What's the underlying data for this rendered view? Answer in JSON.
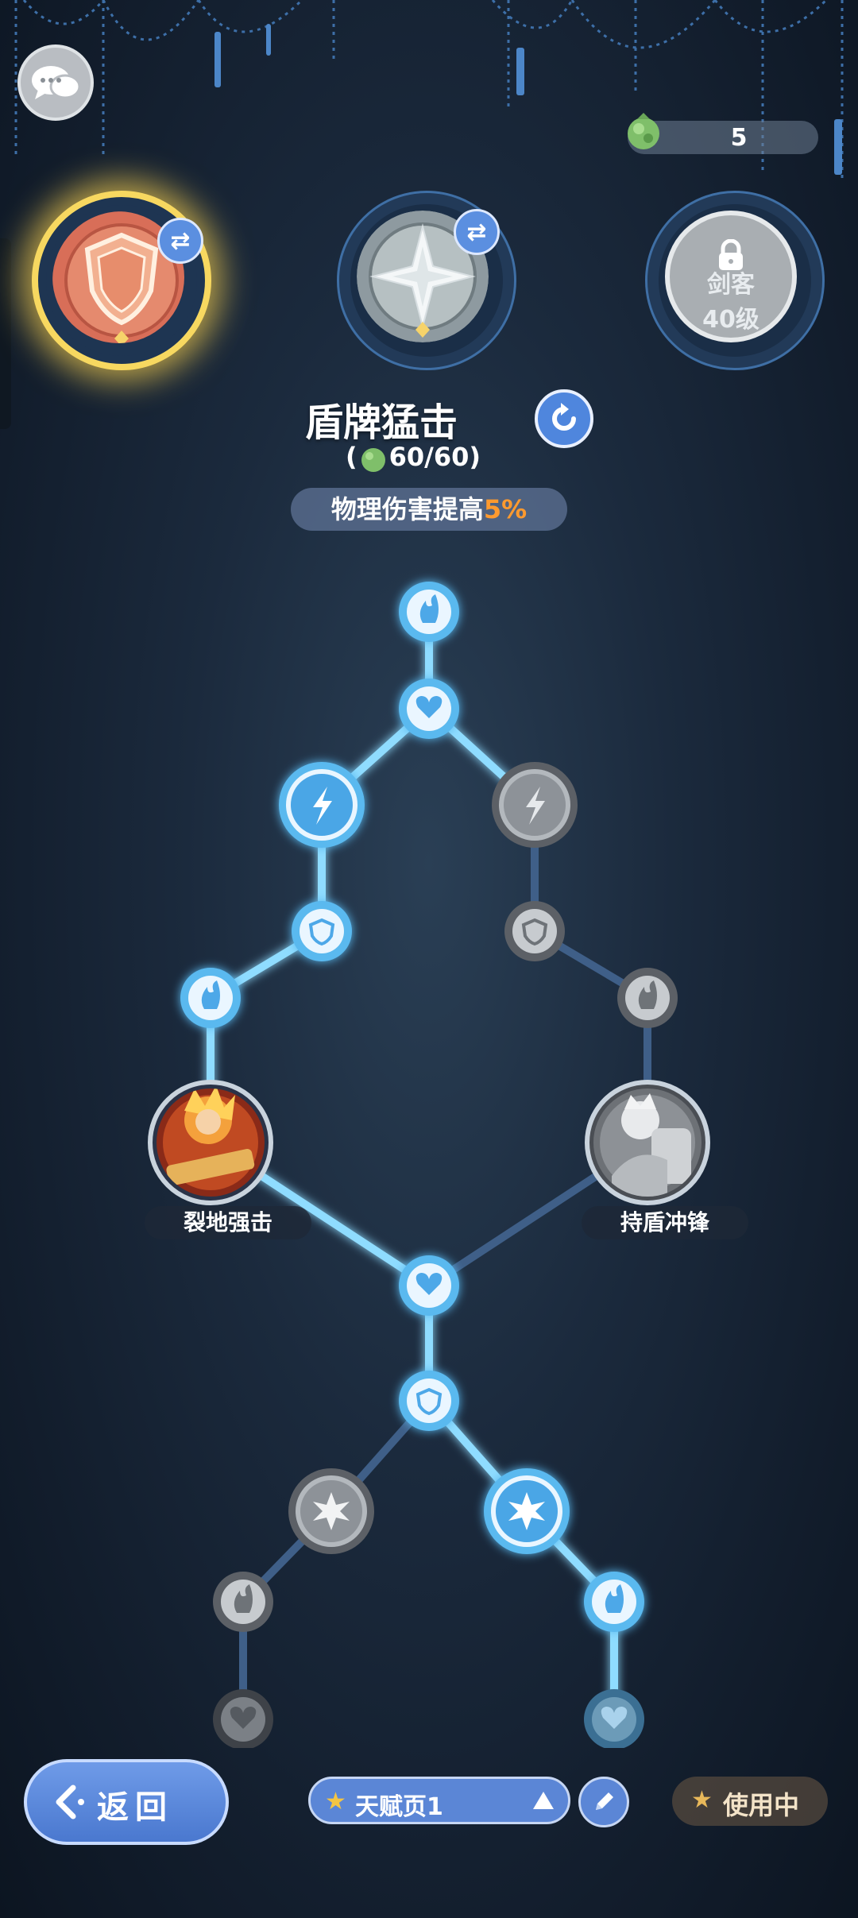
{
  "colors": {
    "accent_blue": "#5b86d6",
    "active_node": "#74d6ff",
    "inactive_node": "#8d9298",
    "gold_glow": "#f7d860",
    "highlight_orange": "#ff9a2e"
  },
  "currency": {
    "icon": "green-gem-icon",
    "amount": "5"
  },
  "chat": {
    "icon": "chat-bubbles-icon"
  },
  "skill_slots": [
    {
      "name": "shield-emblem",
      "selected": true,
      "swap_icon": "⇄"
    },
    {
      "name": "star-emblem",
      "selected": false,
      "swap_icon": "⇄"
    },
    {
      "name": "locked",
      "lock_icon": "lock-icon",
      "locked_line1": "剑客",
      "locked_line2": "40级"
    }
  ],
  "skill": {
    "title": "盾牌猛击",
    "cost_prefix": "(",
    "cost_value": "60/60",
    "cost_suffix": ")",
    "effect_text": "物理伤害提高",
    "effect_value": "5%"
  },
  "tree": {
    "skill_nodes": [
      {
        "label": "裂地强击",
        "state": "active"
      },
      {
        "label": "持盾冲锋",
        "state": "inactive"
      }
    ]
  },
  "bottom": {
    "back_label": "返回",
    "page_label": "天赋页1",
    "in_use_label": "使用中"
  }
}
